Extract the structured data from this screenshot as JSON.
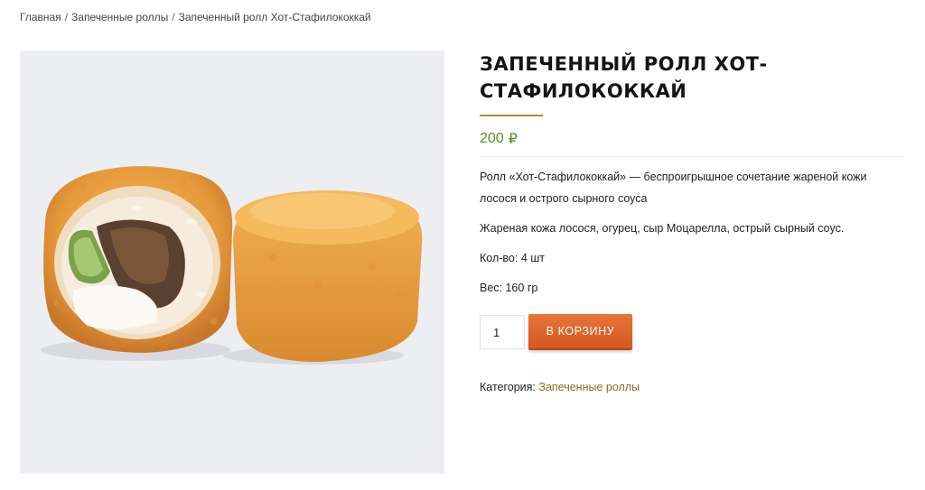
{
  "breadcrumb": {
    "home": "Главная",
    "separator": "/",
    "category": "Запеченные роллы",
    "current": "Запеченный ролл Хот-Стафилококкай"
  },
  "product": {
    "title": "Запеченный ролл Хот-Стафилококкай",
    "price": "200",
    "currency": "₽",
    "description": "Ролл «Хот-Стафилококкай» — беспроигрышное сочетание жареной кожи лосося и острого сырного соуса",
    "ingredients": "Жареная кожа лосося, огурец, сыр Моцарелла, острый сырный соус.",
    "quantity_label": "Кол-во: 4 шт",
    "weight_label": "Вес: 160 гр"
  },
  "cart": {
    "quantity": "1",
    "add_button": "В корзину"
  },
  "meta": {
    "category_label": "Категория:",
    "category_value": "Запеченные роллы"
  },
  "colors": {
    "price": "#5d8a2a",
    "button": "#e0682f",
    "title_rule": "#b08b3c",
    "category_link": "#8b6a1d",
    "image_background": "#edeef2"
  }
}
